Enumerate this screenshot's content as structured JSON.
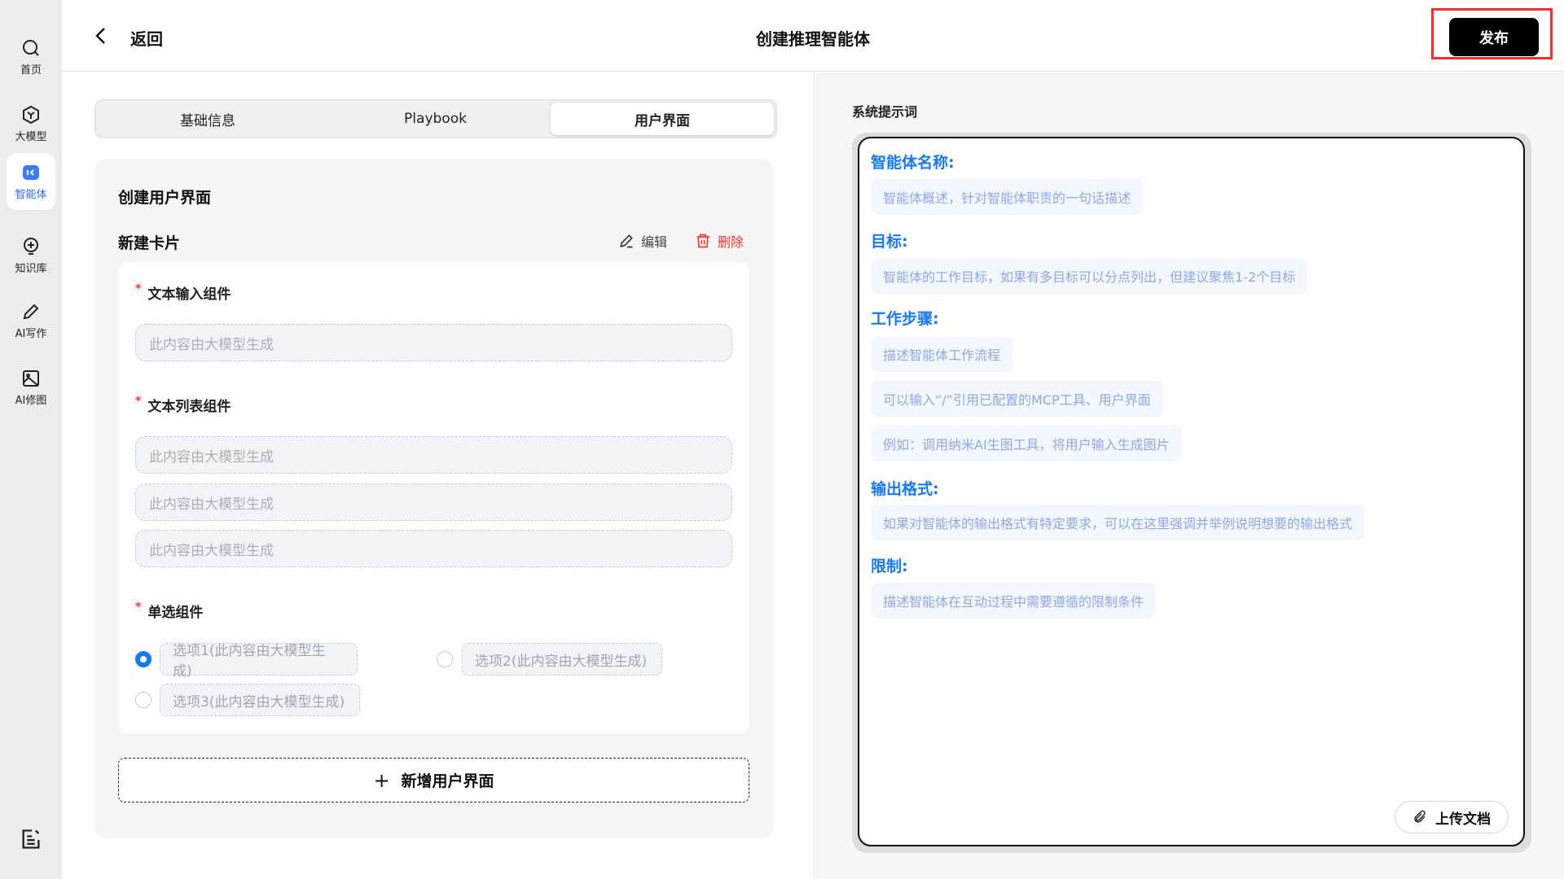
{
  "sidebar": {
    "items": [
      {
        "label": "首页",
        "icon": "search-icon"
      },
      {
        "label": "大模型",
        "icon": "cube-icon"
      },
      {
        "label": "智能体",
        "icon": "agent-icon",
        "active": true
      },
      {
        "label": "知识库",
        "icon": "bulb-icon"
      },
      {
        "label": "AI写作",
        "icon": "pen-icon"
      },
      {
        "label": "AI修图",
        "icon": "image-icon"
      }
    ]
  },
  "header": {
    "back_label": "返回",
    "title": "创建推理智能体",
    "publish_label": "发布"
  },
  "tabs": [
    {
      "label": "基础信息"
    },
    {
      "label": "Playbook"
    },
    {
      "label": "用户界面",
      "active": true
    }
  ],
  "card": {
    "title": "创建用户界面",
    "subtitle": "新建卡片",
    "edit_label": "编辑",
    "delete_label": "删除",
    "text_input": {
      "label": "文本输入组件",
      "required_mark": "*",
      "placeholder": "此内容由大模型生成"
    },
    "text_list": {
      "label": "文本列表组件",
      "required_mark": "*",
      "items": [
        "此内容由大模型生成",
        "此内容由大模型生成",
        "此内容由大模型生成"
      ]
    },
    "radio": {
      "label": "单选组件",
      "required_mark": "*",
      "options": [
        "选项1(此内容由大模型生成)",
        "选项2(此内容由大模型生成)",
        "选项3(此内容由大模型生成)"
      ],
      "selected": 0
    },
    "add_label": "新增用户界面"
  },
  "prompt": {
    "title": "系统提示词",
    "sections": [
      {
        "heading": "智能体名称:",
        "chips": [
          "智能体概述，针对智能体职责的一句话描述"
        ]
      },
      {
        "heading": "目标:",
        "chips": [
          "智能体的工作目标，如果有多目标可以分点列出，但建议聚焦1-2个目标"
        ]
      },
      {
        "heading": "工作步骤:",
        "chips": [
          "描述智能体工作流程",
          "可以输入“/”引用已配置的MCP工具、用户界面",
          "例如：调用纳米AI生图工具，将用户输入生成图片"
        ]
      },
      {
        "heading": "输出格式:",
        "chips": [
          "如果对智能体的输出格式有特定要求，可以在这里强调并举例说明想要的输出格式"
        ]
      },
      {
        "heading": "限制:",
        "chips": [
          "描述智能体在互动过程中需要遵循的限制条件"
        ]
      }
    ],
    "upload_label": "上传文档"
  },
  "colors": {
    "accent": "#1677ff",
    "highlight": "#ff2a2a"
  }
}
